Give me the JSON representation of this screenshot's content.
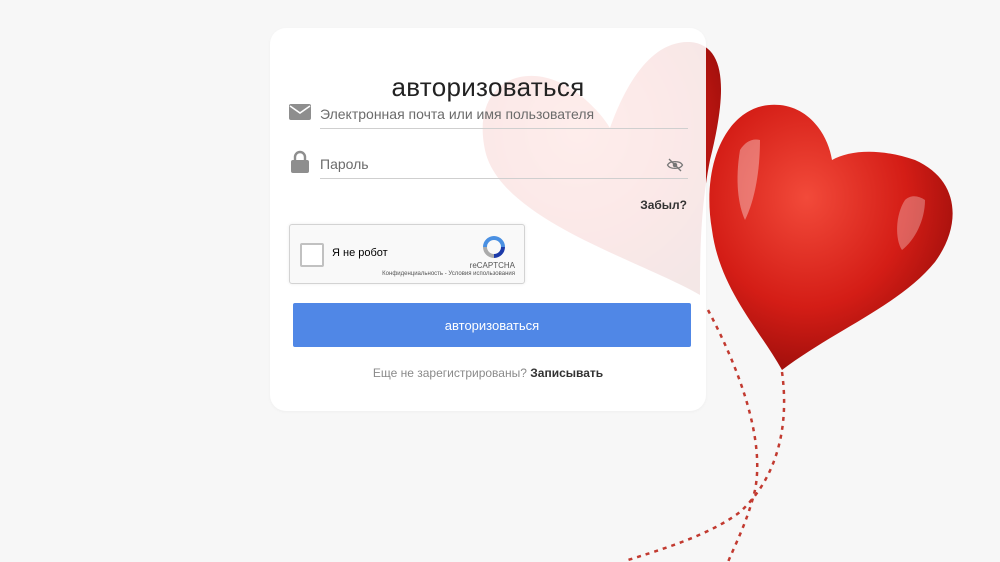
{
  "login": {
    "title": "авторизоваться",
    "email_placeholder": "Электронная почта или имя пользователя",
    "password_placeholder": "Пароль",
    "forgot_label": "Забыл?",
    "submit_label": "авторизоваться",
    "register_prompt": "Еще не зарегистрированы?",
    "register_link": "Записывать"
  },
  "recaptcha": {
    "checkbox_label": "Я не робот",
    "brand": "reCAPTCHA",
    "privacy_label": "Конфиденциальность",
    "separator": " - ",
    "terms_label": "Условия использования"
  },
  "icons": {
    "email": "envelope-icon",
    "password": "lock-icon",
    "toggle_visibility": "eye-slash-icon",
    "captcha": "recaptcha-logo-icon"
  },
  "colors": {
    "accent": "#5087e6",
    "heart": "#d91f1a",
    "background": "#f7f7f7"
  }
}
